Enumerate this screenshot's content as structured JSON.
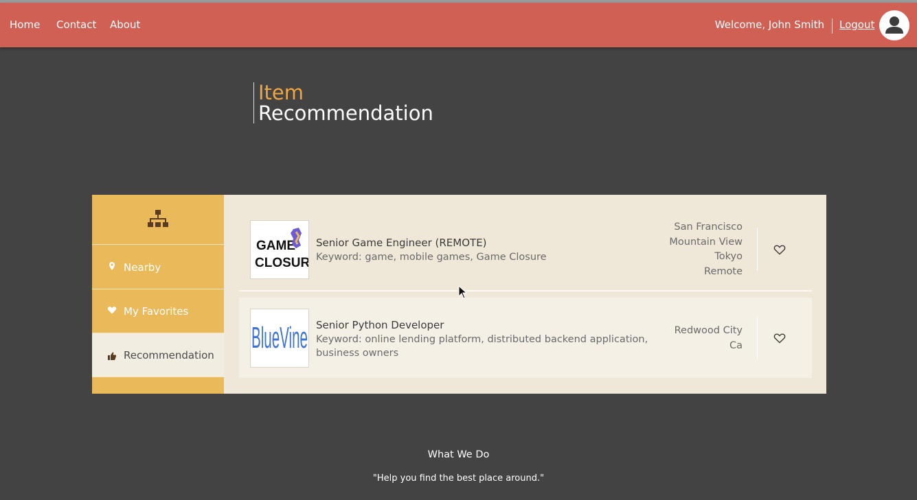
{
  "nav": {
    "links": [
      "Home",
      "Contact",
      "About"
    ],
    "welcome": "Welcome, John Smith",
    "logout": "Logout",
    "avatar_icon": "user-icon"
  },
  "header": {
    "title_line1": "Item",
    "title_line2": "Recommendation"
  },
  "sidebar": {
    "top_icon": "sitemap-icon",
    "items": [
      {
        "label": "Nearby",
        "icon": "map-marker-icon"
      },
      {
        "label": "My Favorites",
        "icon": "heart-icon"
      },
      {
        "label": "Recommendation",
        "icon": "thumbs-up-icon",
        "active": true
      }
    ]
  },
  "items": [
    {
      "logo_text_1": "GAME",
      "logo_text_2": "CLOSURE",
      "title": "Senior Game Engineer (REMOTE)",
      "keywords": "Keyword: game, mobile games, Game Closure",
      "locations": [
        "San Francisco",
        "Mountain View",
        "Tokyo",
        "Remote"
      ]
    },
    {
      "logo_text_1": "BlueVine",
      "title": "Senior Python Developer",
      "keywords": "Keyword: online lending platform, distributed backend application, business owners",
      "locations": [
        "Redwood City",
        "Ca"
      ]
    }
  ],
  "footer": {
    "title": "What We Do",
    "quote": "\"Help you find the best place around.\""
  },
  "colors": {
    "navbar": "#d16054",
    "background": "#434343",
    "sidebar": "#e9b95a",
    "panel": "#efe8d8",
    "title_accent": "#f0a742"
  }
}
